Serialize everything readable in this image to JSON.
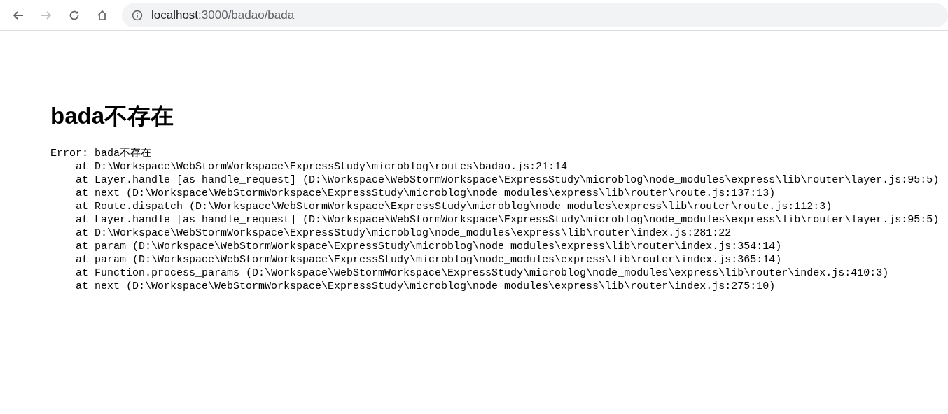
{
  "browser": {
    "buttons": [
      {
        "kind": "back",
        "disabled": false
      },
      {
        "kind": "forward",
        "disabled": true
      },
      {
        "kind": "reload",
        "disabled": false
      },
      {
        "kind": "home",
        "disabled": false
      }
    ],
    "url": {
      "host": "localhost",
      "path": ":3000/badao/bada"
    }
  },
  "page": {
    "heading": "bada不存在",
    "error": {
      "message": "Error: bada不存在",
      "stack": [
        "at D:\\Workspace\\WebStormWorkspace\\ExpressStudy\\microblog\\routes\\badao.js:21:14",
        "at Layer.handle [as handle_request] (D:\\Workspace\\WebStormWorkspace\\ExpressStudy\\microblog\\node_modules\\express\\lib\\router\\layer.js:95:5)",
        "at next (D:\\Workspace\\WebStormWorkspace\\ExpressStudy\\microblog\\node_modules\\express\\lib\\router\\route.js:137:13)",
        "at Route.dispatch (D:\\Workspace\\WebStormWorkspace\\ExpressStudy\\microblog\\node_modules\\express\\lib\\router\\route.js:112:3)",
        "at Layer.handle [as handle_request] (D:\\Workspace\\WebStormWorkspace\\ExpressStudy\\microblog\\node_modules\\express\\lib\\router\\layer.js:95:5)",
        "at D:\\Workspace\\WebStormWorkspace\\ExpressStudy\\microblog\\node_modules\\express\\lib\\router\\index.js:281:22",
        "at param (D:\\Workspace\\WebStormWorkspace\\ExpressStudy\\microblog\\node_modules\\express\\lib\\router\\index.js:354:14)",
        "at param (D:\\Workspace\\WebStormWorkspace\\ExpressStudy\\microblog\\node_modules\\express\\lib\\router\\index.js:365:14)",
        "at Function.process_params (D:\\Workspace\\WebStormWorkspace\\ExpressStudy\\microblog\\node_modules\\express\\lib\\router\\index.js:410:3)",
        "at next (D:\\Workspace\\WebStormWorkspace\\ExpressStudy\\microblog\\node_modules\\express\\lib\\router\\index.js:275:10)"
      ]
    }
  }
}
